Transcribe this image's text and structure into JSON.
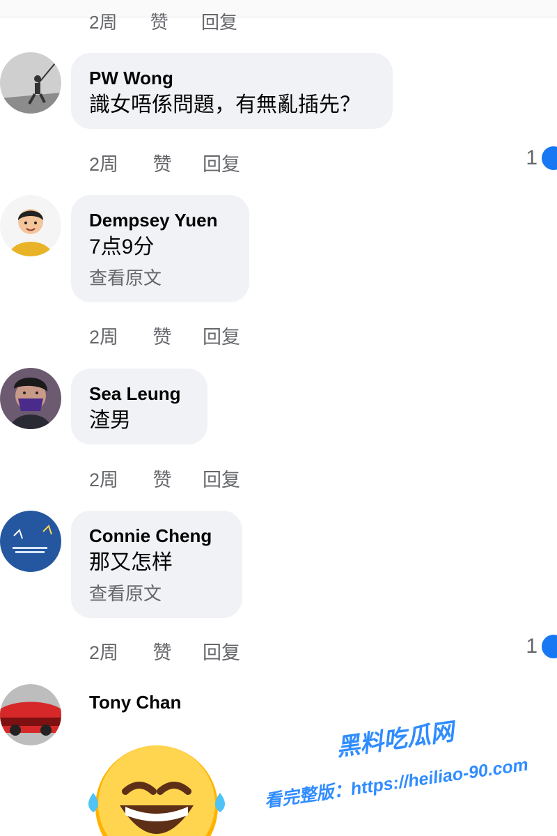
{
  "top_actions": {
    "time": "2周",
    "like": "赞",
    "reply": "回复"
  },
  "comments": [
    {
      "name": "PW Wong",
      "text": "識女唔係問題，有無亂插先？",
      "see_original": "",
      "time": "2周",
      "like": "赞",
      "reply": "回复",
      "like_count": "1",
      "avatar_icon": "fisherman-avatar"
    },
    {
      "name": "Dempsey Yuen",
      "text": "7点9分",
      "see_original": "查看原文",
      "time": "2周",
      "like": "赞",
      "reply": "回复",
      "like_count": "",
      "avatar_icon": "cartoon-boy-avatar"
    },
    {
      "name": "Sea Leung",
      "text": "渣男",
      "see_original": "",
      "time": "2周",
      "like": "赞",
      "reply": "回复",
      "like_count": "",
      "avatar_icon": "masked-person-avatar"
    },
    {
      "name": "Connie Cheng",
      "text": "那又怎样",
      "see_original": "查看原文",
      "time": "2周",
      "like": "赞",
      "reply": "回复",
      "like_count": "1",
      "avatar_icon": "blue-poster-avatar"
    },
    {
      "name": "Tony Chan",
      "text": "",
      "see_original": "",
      "time": "",
      "like": "",
      "reply": "",
      "like_count": "",
      "avatar_icon": "red-car-avatar"
    }
  ],
  "sticker": {
    "icon": "laughing-tears-emoji"
  },
  "watermark": {
    "title": "黑料吃瓜网",
    "line": "看完整版：https://heiliao-90.com"
  },
  "colors": {
    "bubble": "#f0f2f5",
    "meta": "#65676b",
    "like_blue": "#1877f2"
  }
}
